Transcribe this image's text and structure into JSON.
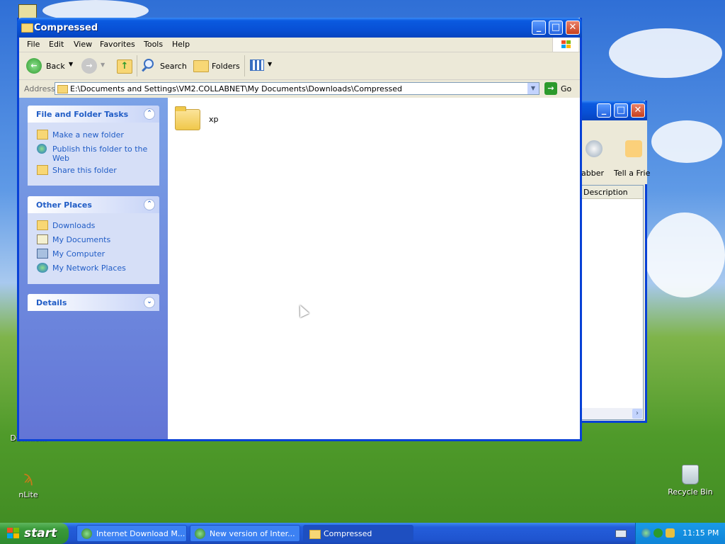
{
  "desktop": {
    "icons": [
      {
        "label": "Downlo..."
      },
      {
        "label": "nLite"
      },
      {
        "label": "Recycle Bin"
      }
    ]
  },
  "window": {
    "title": "Compressed",
    "menu": [
      "File",
      "Edit",
      "View",
      "Favorites",
      "Tools",
      "Help"
    ],
    "toolbar": {
      "back": "Back",
      "search": "Search",
      "folders": "Folders"
    },
    "address": {
      "label": "Address",
      "value": "E:\\Documents and Settings\\VM2.COLLABNET\\My Documents\\Downloads\\Compressed",
      "go": "Go"
    },
    "tasks": {
      "title": "File and Folder Tasks",
      "items": [
        "Make a new folder",
        "Publish this folder to the Web",
        "Share this folder"
      ]
    },
    "other_places": {
      "title": "Other Places",
      "items": [
        "Downloads",
        "My Documents",
        "My Computer",
        "My Network Places"
      ]
    },
    "details": {
      "title": "Details"
    },
    "files": [
      {
        "name": "xp"
      }
    ]
  },
  "background_window": {
    "toolbar_labels": [
      "abber",
      "Tell a Frie"
    ],
    "column_header": "Description"
  },
  "taskbar": {
    "start": "start",
    "tasks": [
      "Internet Download M...",
      "New version of Inter...",
      "Compressed"
    ],
    "clock": "11:15 PM"
  },
  "colors": {
    "accent": "#0a5ae0",
    "link": "#215dc6",
    "taskbar": "#245edb"
  }
}
